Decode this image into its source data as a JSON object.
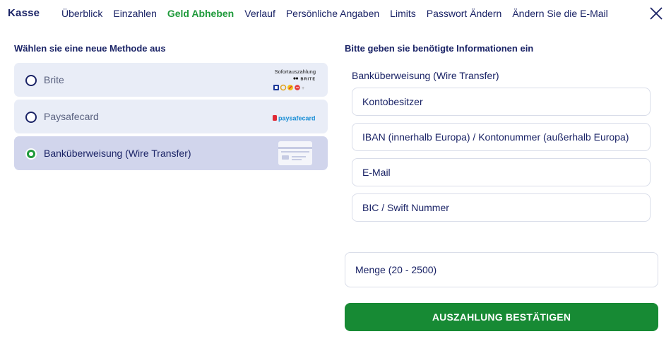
{
  "header": {
    "brand": "Kasse",
    "nav": [
      {
        "label": "Überblick",
        "active": false
      },
      {
        "label": "Einzahlen",
        "active": false
      },
      {
        "label": "Geld Abheben",
        "active": true
      },
      {
        "label": "Verlauf",
        "active": false
      },
      {
        "label": "Persönliche Angaben",
        "active": false
      },
      {
        "label": "Limits",
        "active": false
      },
      {
        "label": "Passwort Ändern",
        "active": false
      },
      {
        "label": "Ändern Sie die E-Mail",
        "active": false
      }
    ],
    "close_icon": "close-icon"
  },
  "methods": {
    "title": "Wählen sie eine neue Methode aus",
    "items": [
      {
        "label": "Brite",
        "selected": false,
        "logo_line1": "Sofortauszahlung",
        "logo_line2": "BRITE"
      },
      {
        "label": "Paysafecard",
        "selected": false,
        "logo_brand": "paysafecard"
      },
      {
        "label": "Banküberweisung (Wire Transfer)",
        "selected": true,
        "logo_icon": "bank-card-icon"
      }
    ]
  },
  "form": {
    "title": "Bitte geben sie benötigte Informationen ein",
    "method_label": "Banküberweisung (Wire Transfer)",
    "fields": {
      "owner_placeholder": "Kontobesitzer",
      "iban_placeholder": "IBAN (innerhalb Europa) / Kontonummer (außerhalb Europa)",
      "email_placeholder": "E-Mail",
      "bic_placeholder": "BIC / Swift Nummer"
    },
    "amount_placeholder": "Menge (20 - 2500)",
    "submit_label": "AUSZAHLUNG BESTÄTIGEN"
  },
  "colors": {
    "primary_text": "#1a2366",
    "accent_green": "#1f9a3b",
    "button_green": "#178a34",
    "card_bg": "#e9edf7",
    "card_selected_bg": "#d1d5ec"
  }
}
